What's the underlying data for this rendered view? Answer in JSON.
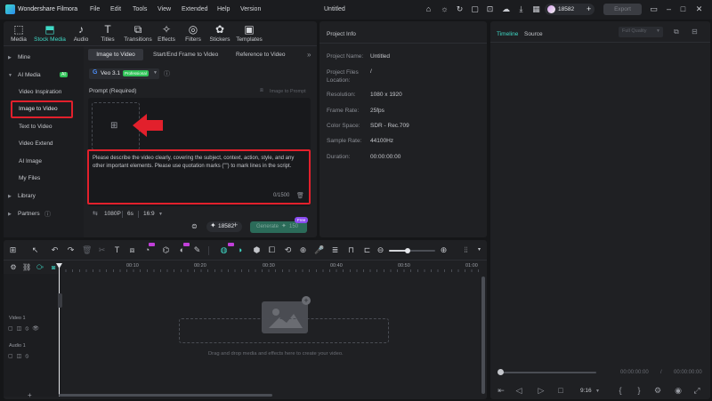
{
  "app": {
    "name": "Wondershare Filmora",
    "doc_title": "Untitled",
    "credits": "18582",
    "export_label": "Export",
    "menu": [
      "File",
      "Edit",
      "Tools",
      "View",
      "Extended",
      "Help",
      "Version"
    ]
  },
  "toolbar": {
    "tabs": [
      {
        "label": "Media",
        "icon": "media-icon"
      },
      {
        "label": "Stock Media",
        "icon": "stock-media-icon"
      },
      {
        "label": "Audio",
        "icon": "audio-icon"
      },
      {
        "label": "Titles",
        "icon": "titles-icon"
      },
      {
        "label": "Transitions",
        "icon": "transitions-icon"
      },
      {
        "label": "Effects",
        "icon": "effects-icon"
      },
      {
        "label": "Filters",
        "icon": "filters-icon"
      },
      {
        "label": "Stickers",
        "icon": "stickers-icon"
      },
      {
        "label": "Templates",
        "icon": "templates-icon"
      }
    ]
  },
  "sidebar": {
    "mine": "Mine",
    "ai_media": "AI Media",
    "ai_badge": "AI",
    "items": [
      "Video Inspiration",
      "Image to Video",
      "Text to Video",
      "Video Extend",
      "AI Image",
      "My Files"
    ],
    "library": "Library",
    "partners": "Partners"
  },
  "generator": {
    "tabs": [
      "Image to Video",
      "Start/End Frame to Video",
      "Reference to Video"
    ],
    "model": "Veo 3.1",
    "model_badge": "Professional",
    "prompt_label": "Prompt (Required)",
    "image_to_prompt": "Image to Prompt",
    "prompt_placeholder": "Please describe the video clearly, covering the subject, context, action, style, and any other important elements. Please use quotation marks (\"\") to mark lines in the script.",
    "char_count": "0/1500",
    "resolution": "1080P",
    "duration": "6s",
    "ratio": "16:9",
    "credits": "18582",
    "generate_label": "Generate",
    "generate_cost": "150",
    "free_badge": "Free"
  },
  "project_info": {
    "header": "Project Info",
    "rows": [
      {
        "key": "Project Name:",
        "value": "Untitled"
      },
      {
        "key": "Project Files Location:",
        "value": "/"
      },
      {
        "key": "Resolution:",
        "value": "1080 x 1920"
      },
      {
        "key": "Frame Rate:",
        "value": "25fps"
      },
      {
        "key": "Color Space:",
        "value": "SDR - Rec.709"
      },
      {
        "key": "Sample Rate:",
        "value": "44100Hz"
      },
      {
        "key": "Duration:",
        "value": "00:00:00:00"
      }
    ]
  },
  "preview": {
    "tab_timeline": "Timeline",
    "tab_source": "Source",
    "quality": "Full Quality",
    "time_current": "00:00:00:00",
    "time_total": "00:00:00:00",
    "ratio": "9:16"
  },
  "timeline": {
    "ruler": [
      "00:10",
      "00:20",
      "00:30",
      "00:40",
      "00:50",
      "01:00"
    ],
    "tracks": [
      "Video 1",
      "Audio 1"
    ],
    "drop_hint": "Drag and drop media and effects here to create your video."
  },
  "colors": {
    "accent": "#3fd9c6",
    "highlight": "#e2202c",
    "badge_pink": "#c23fd9",
    "badge_green": "#2fc257"
  }
}
